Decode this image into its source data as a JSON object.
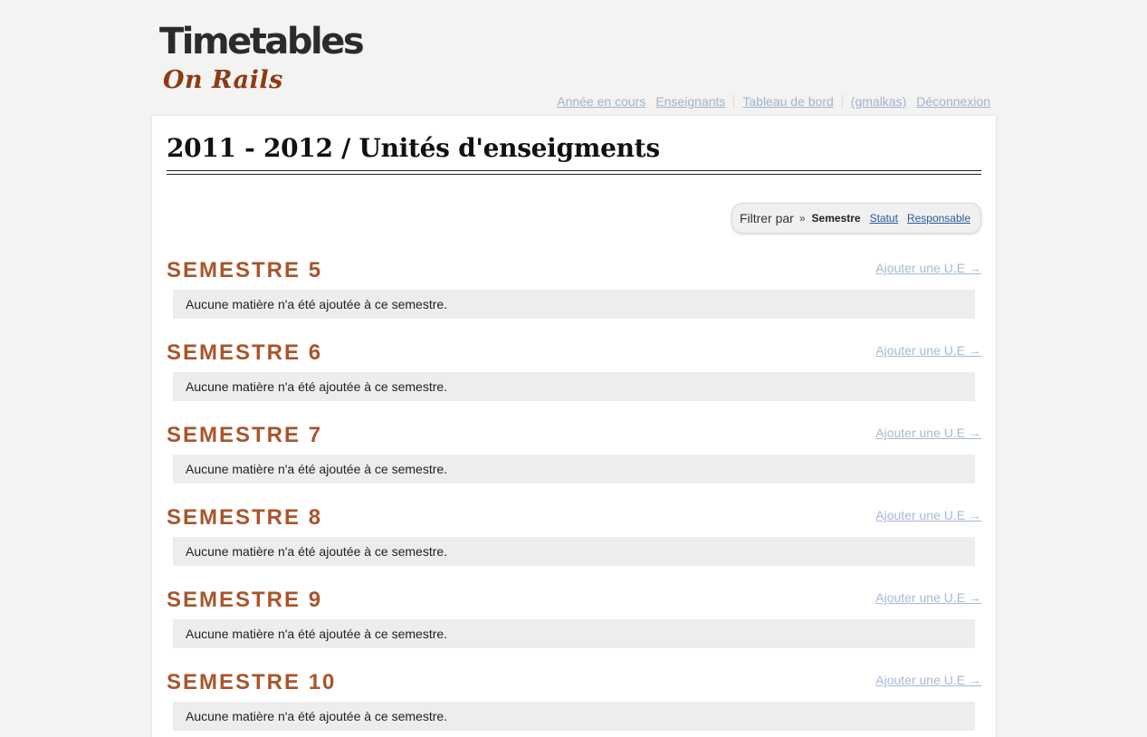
{
  "logo": {
    "title": "Timetables",
    "subtitle": "On Rails"
  },
  "nav": {
    "items": [
      "Année en cours",
      "Enseignants",
      "Tableau de bord",
      "(gmalkas)",
      "Déconnexion"
    ]
  },
  "page": {
    "title": "2011 - 2012 / Unités d'enseigments"
  },
  "filter": {
    "label": "Filtrer par",
    "separator": "»",
    "active": "Semestre",
    "options": [
      "Statut",
      "Responsable"
    ]
  },
  "semesters": [
    {
      "title": "SEMESTRE 5",
      "add_label": "Ajouter une U.E →",
      "empty_text": "Aucune matière n'a été ajoutée à ce semestre."
    },
    {
      "title": "SEMESTRE 6",
      "add_label": "Ajouter une U.E →",
      "empty_text": "Aucune matière n'a été ajoutée à ce semestre."
    },
    {
      "title": "SEMESTRE 7",
      "add_label": "Ajouter une U.E →",
      "empty_text": "Aucune matière n'a été ajoutée à ce semestre."
    },
    {
      "title": "SEMESTRE 8",
      "add_label": "Ajouter une U.E →",
      "empty_text": "Aucune matière n'a été ajoutée à ce semestre."
    },
    {
      "title": "SEMESTRE 9",
      "add_label": "Ajouter une U.E →",
      "empty_text": "Aucune matière n'a été ajoutée à ce semestre."
    },
    {
      "title": "SEMESTRE 10",
      "add_label": "Ajouter une U.E →",
      "empty_text": "Aucune matière n'a été ajoutée à ce semestre."
    }
  ],
  "colors": {
    "semester_title": "#a9552a",
    "link_muted": "#9fb4cc",
    "link_filter": "#2a5a94",
    "logo_subtitle": "#8e3a14"
  }
}
